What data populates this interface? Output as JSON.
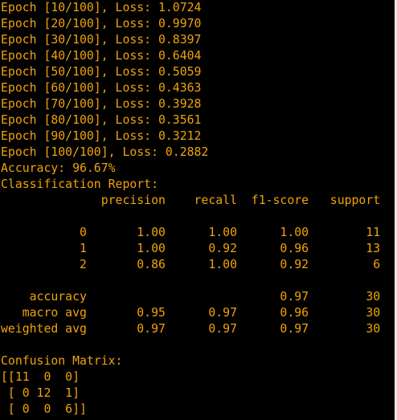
{
  "colors": {
    "background": "#000000",
    "text": "#f0a30a",
    "scrollbar": "#e6e6e6"
  },
  "console": {
    "lines": [
      "Epoch [10/100], Loss: 1.0724",
      "Epoch [20/100], Loss: 0.9970",
      "Epoch [30/100], Loss: 0.8397",
      "Epoch [40/100], Loss: 0.6404",
      "Epoch [50/100], Loss: 0.5059",
      "Epoch [60/100], Loss: 0.4363",
      "Epoch [70/100], Loss: 0.3928",
      "Epoch [80/100], Loss: 0.3561",
      "Epoch [90/100], Loss: 0.3212",
      "Epoch [100/100], Loss: 0.2882",
      "Accuracy: 96.67%",
      "Classification Report:",
      "              precision    recall  f1-score   support",
      "",
      "           0       1.00      1.00      1.00        11",
      "           1       1.00      0.92      0.96        13",
      "           2       0.86      1.00      0.92         6",
      "",
      "    accuracy                           0.97        30",
      "   macro avg       0.95      0.97      0.96        30",
      "weighted avg       0.97      0.97      0.97        30",
      "",
      "Confusion Matrix:",
      "[[11  0  0]",
      " [ 0 12  1]",
      " [ 0  0  6]]"
    ]
  }
}
